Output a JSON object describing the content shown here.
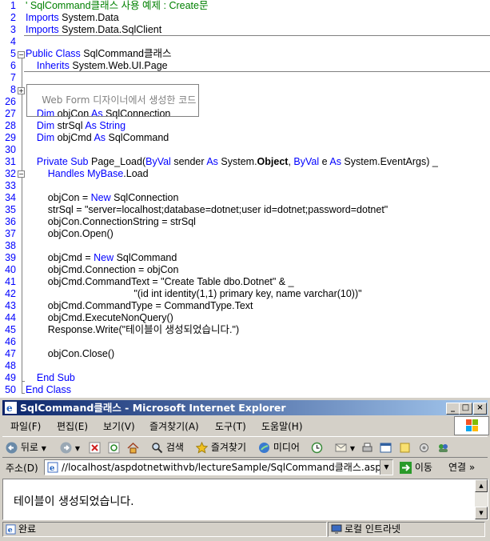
{
  "code": {
    "lines": [
      {
        "n": "1",
        "segments": [
          {
            "t": "' SqlCommand클래스 사용 예제 : Create문",
            "c": "cm"
          }
        ]
      },
      {
        "n": "2",
        "segments": [
          {
            "t": "Imports",
            "c": "kw"
          },
          {
            "t": " System.Data",
            "c": ""
          }
        ]
      },
      {
        "n": "3",
        "segments": [
          {
            "t": "Imports",
            "c": "kw"
          },
          {
            "t": " System.Data.SqlClient",
            "c": ""
          }
        ]
      },
      {
        "n": "4",
        "segments": []
      },
      {
        "n": "5",
        "segments": [
          {
            "t": "Public Class",
            "c": "kw"
          },
          {
            "t": " SqlCommand클래스",
            "c": ""
          }
        ]
      },
      {
        "n": "6",
        "segments": [
          {
            "t": "    Inherits",
            "c": "kw"
          },
          {
            "t": " System.Web.UI.Page",
            "c": ""
          }
        ]
      },
      {
        "n": "7",
        "segments": []
      },
      {
        "n": "8",
        "segments": []
      },
      {
        "n": "26",
        "segments": []
      },
      {
        "n": "27",
        "segments": [
          {
            "t": "    Dim",
            "c": "kw"
          },
          {
            "t": " objCon ",
            "c": ""
          },
          {
            "t": "As",
            "c": "kw"
          },
          {
            "t": " SqlConnection",
            "c": ""
          }
        ]
      },
      {
        "n": "28",
        "segments": [
          {
            "t": "    Dim",
            "c": "kw"
          },
          {
            "t": " strSql ",
            "c": ""
          },
          {
            "t": "As String",
            "c": "kw"
          }
        ]
      },
      {
        "n": "29",
        "segments": [
          {
            "t": "    Dim",
            "c": "kw"
          },
          {
            "t": " objCmd ",
            "c": ""
          },
          {
            "t": "As",
            "c": "kw"
          },
          {
            "t": " SqlCommand",
            "c": ""
          }
        ]
      },
      {
        "n": "30",
        "segments": []
      },
      {
        "n": "31",
        "segments": [
          {
            "t": "    Private Sub",
            "c": "kw"
          },
          {
            "t": " Page_Load(",
            "c": ""
          },
          {
            "t": "ByVal",
            "c": "kw"
          },
          {
            "t": " sender ",
            "c": ""
          },
          {
            "t": "As",
            "c": "kw"
          },
          {
            "t": " System.",
            "c": ""
          },
          {
            "t": "Object",
            "c": "b"
          },
          {
            "t": ", ",
            "c": ""
          },
          {
            "t": "ByVal",
            "c": "kw"
          },
          {
            "t": " e ",
            "c": ""
          },
          {
            "t": "As",
            "c": "kw"
          },
          {
            "t": " System.EventArgs) _",
            "c": ""
          }
        ]
      },
      {
        "n": "32",
        "segments": [
          {
            "t": "        Handles MyBase",
            "c": "kw"
          },
          {
            "t": ".Load",
            "c": ""
          }
        ]
      },
      {
        "n": "33",
        "segments": []
      },
      {
        "n": "34",
        "segments": [
          {
            "t": "        objCon = ",
            "c": ""
          },
          {
            "t": "New",
            "c": "kw"
          },
          {
            "t": " SqlConnection",
            "c": ""
          }
        ]
      },
      {
        "n": "35",
        "segments": [
          {
            "t": "        strSql = \"server=localhost;database=dotnet;user id=dotnet;password=dotnet\"",
            "c": ""
          }
        ]
      },
      {
        "n": "36",
        "segments": [
          {
            "t": "        objCon.ConnectionString = strSql",
            "c": ""
          }
        ]
      },
      {
        "n": "37",
        "segments": [
          {
            "t": "        objCon.Open()",
            "c": ""
          }
        ]
      },
      {
        "n": "38",
        "segments": []
      },
      {
        "n": "39",
        "segments": [
          {
            "t": "        objCmd = ",
            "c": ""
          },
          {
            "t": "New",
            "c": "kw"
          },
          {
            "t": " SqlCommand",
            "c": ""
          }
        ]
      },
      {
        "n": "40",
        "segments": [
          {
            "t": "        objCmd.Connection = objCon",
            "c": ""
          }
        ]
      },
      {
        "n": "41",
        "segments": [
          {
            "t": "        objCmd.CommandText = \"Create Table dbo.Dotnet\" & _",
            "c": ""
          }
        ]
      },
      {
        "n": "42",
        "segments": [
          {
            "t": "                                       \"(id int identity(1,1) primary key, name varchar(10))\"",
            "c": ""
          }
        ]
      },
      {
        "n": "43",
        "segments": [
          {
            "t": "        objCmd.CommandType = CommandType.Text",
            "c": ""
          }
        ]
      },
      {
        "n": "44",
        "segments": [
          {
            "t": "        objCmd.ExecuteNonQuery()",
            "c": ""
          }
        ]
      },
      {
        "n": "45",
        "segments": [
          {
            "t": "        Response.Write(\"테이블이 생성되었습니다.\")",
            "c": ""
          }
        ]
      },
      {
        "n": "46",
        "segments": []
      },
      {
        "n": "47",
        "segments": [
          {
            "t": "        objCon.Close()",
            "c": ""
          }
        ]
      },
      {
        "n": "48",
        "segments": []
      },
      {
        "n": "49",
        "segments": [
          {
            "t": "    End Sub",
            "c": "kw"
          }
        ]
      },
      {
        "n": "50",
        "segments": [
          {
            "t": "End Class",
            "c": "kw"
          }
        ]
      }
    ],
    "region_label": "Web Form 디자이너에서 생성한 코드"
  },
  "window": {
    "title": "SqlCommand클래스 - Microsoft Internet Explorer",
    "minimize": "_",
    "maximize": "□",
    "close": "×"
  },
  "menu": [
    "파일(F)",
    "편집(E)",
    "보기(V)",
    "즐겨찾기(A)",
    "도구(T)",
    "도움말(H)"
  ],
  "toolbar": {
    "back": "뒤로",
    "search": "검색",
    "favorites": "즐겨찾기",
    "media": "미디어"
  },
  "address": {
    "label": "주소(D)",
    "url": "//localhost/aspdotnetwithvb/lectureSample/SqlCommand클래스.aspx",
    "go": "이동",
    "links": "연결"
  },
  "content": {
    "text": "테이블이 생성되었습니다."
  },
  "status": {
    "left": "완료",
    "zone": "로컬 인트라넷"
  },
  "colors": {
    "keyword": "#0000ff",
    "comment": "#008000",
    "titlebar_start": "#0a246a",
    "titlebar_end": "#a6caf0"
  }
}
